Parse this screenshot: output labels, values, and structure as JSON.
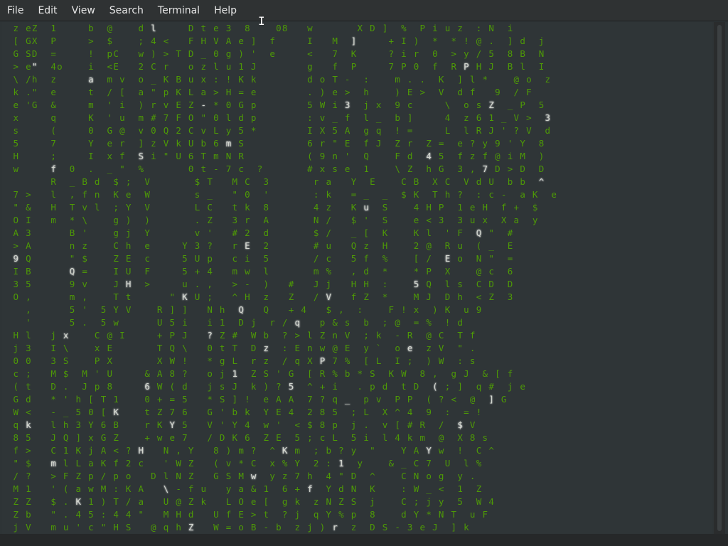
{
  "menubar": {
    "items": [
      "File",
      "Edit",
      "View",
      "Search",
      "Terminal",
      "Help"
    ]
  },
  "cursor": {
    "icon": "text-ibeam-cursor-icon",
    "glyph": "I"
  },
  "colors": {
    "background": "#2e3436",
    "terminal_background": "#2f3537",
    "matrix_green": "#4e9a06",
    "matrix_head": "#d3d7cf"
  },
  "terminal": {
    "rows": [
      " z eZ  1     b  @    d l     D t e 3  8    08   w       X D ]  %  P i u z  : N  i",
      " [ GX  P     >  $    ; 4 <   F H V A e ]  f     I   M  ]     + I )  *  * ! @ .  ] d  j",
      " G SD  =     !  pC   w ) > T D _ 0 g ) '  e     <   7  K     ? i r  0  > y / 5  8 B  N",
      " > e\"  4o    i  <E   2 C r   o z l u 1 J        g   f  P     7 P 0  f  R P H J  B l  I",
      " \\ /h  z     a  m v  o _ K B u x : ! K k        d o T -  :    m . .  K  ] l *    @ o  z",
      " k .\"  e     t  / [  a \" p K L a > H = e        . ) e >  h    ) E >  V  d f   9  / F",
      " e 'G  &     m  ' i  ) r v E Z - * 0 G p        5 W i 3  j x  9 c     \\  o s Z  _ P  5",
      " x     q     K  ' u  m # 7 F O \" 0 l d p        : v _ f  l _  b ]     4  z 6 1 _ V >  3",
      " s     (     0  G @  v 0 Q 2 C v L y 5 *        I X 5 A  g q  ! =     L  l R J ' ? V  d",
      " 5     7     Y  e r  ] z V k U b 6 m S          6 r \" E  f J  Z r  Z =  e ? y 9 ' Y  8",
      " H     ;     I  x f  S i \" U 6 T m N R          ( 9 n '  Q    F d  4 5  f z f @ i M  )",
      " w     f  0  .  _ \"  %       0 t - 7 c  ?       # x s e  1    \\ Z  h G  3 , 7 D > D  D",
      "       R  _ B d  $ ;  V       $ T   M C  3       r a   Y  E    C B  X C  V d U  b b  ^",
      " 7 >   l  , f n  K e  W       s _   \" 0  '       : k   = _  _  $ K  T h ?  : c -  a K  e",
      " \" &   H  T v l  ; Y  V       L C   t k  8       4 z   K u  S    4 H P  1 e H  f +  $",
      " O I   m  * \\    g )  )       . Z   3 r  A       N /   $ '  S    e < 3  3 u x  X a  y",
      " A 3      B '    g j  Y       v '   # 2  d       $ /   _ [  K    K l  ' F  Q \"  #",
      " > A      n z    C h  e     Y 3 ?   r E  2       # u   Q z  H    2 @  R u  ( _  E",
      " 9 Q      \" $    Z E  c     5 U p   c i  5       / c   5 f  %    [ /  E o  N \"  =",
      " I B      Q =    I U  F     5 + 4   m w  l       m %   , d  *    * P  X    @ c  6",
      " 3 5      9 v    J H  >     u . ,   > -  )   #   J j   H H  :    5 Q  l s  C D  D",
      " O ,      m ,    T t      \" K U ;   ^ H  z   Z   / V   f Z  *    M J  D h  < Z  3",
      "   ,      5 '  5 Y V    R ] ]   N h  Q   Q   + 4   $ ,  :    F ! x  ) K  u 9",
      "   '      5 .  5 w      U 5 i   i 1  D j  r / q   p & s  b  ; @  = %  ! d",
      " H l   j x    C @ I     + P J   ? Z #  W b  ? > l Z n V  ; k  - R  @ C  T f",
      " j 3   I \\    x E       T Q \\   0 t T  D z  : E n w @ E  y `  o e  z V  \" .",
      " 0 0   3 S    P X       X W !   * g L  r z  / q X P 7 %  [ L  I ;  ) W  : s",
      " c ;   M $  M ' U     & A 8 ?   o j 1  Z S ' G  [ R % b * S  K W  8 ,  g J  & [ f",
      " ( t   D .  J p 8     6 W ( d   j s J  k ) ? 5  ^ + i   . p d  t D  ( ; ]  q #  j e",
      " G d   * ' h [ T 1    0 + = 5   * S ] !  e A A  7 ? q _  p v  P P  ( ? <  @  ] G",
      " W <   - _ 5 0 [ K    t Z 7 6   G ' b k  Y E 4  2 8 5  ; L  X ^ 4  9  :  = !",
      " q k   l h 3 Y 6 B    r K Y 5   V ' Y 4  w '  < $ 8 p  j .  v [ # R  /  $ V",
      " 8 5   J Q ] x G Z    + w e 7   / D K 6  Z E  5 ; c L  5 i  l 4 k m  @  X 8 s",
      " f >   C 1 K j A < ? H   N , Y   8 ) m ?  ^ K m  ; b ? y  \"    Y A Y w  !  C ^",
      " \" $   m l L a K f 2 c   ' W Z   ( v * C  x % Y  2 : 1  y    & _ C 7  U  l %",
      " / ?   > F Z p / p o   D l N Z   G S M w  y z 7 h  4 \" D  ^    C N o g  y .",
      " M 1   ' ( a w M : K A   \\ - f u   y a & 1  6 + f  Y d N  K    : W _ <  1  Z",
      " Z Z   $ . K 1 ) T / a   U @ Z k   L O e [  g k  z N Z S  j    C ; j y  5  W 4",
      " Z b   \" . 4 5 : 4 4 \"   M H d   U f E > t  ? j  q Y % p  8    d Y * N T  u F",
      " j V   m u ' c \" H S   @ q h Z   W = o B - b  z j ) r  z  D S - 3 e J  ] k"
    ]
  }
}
